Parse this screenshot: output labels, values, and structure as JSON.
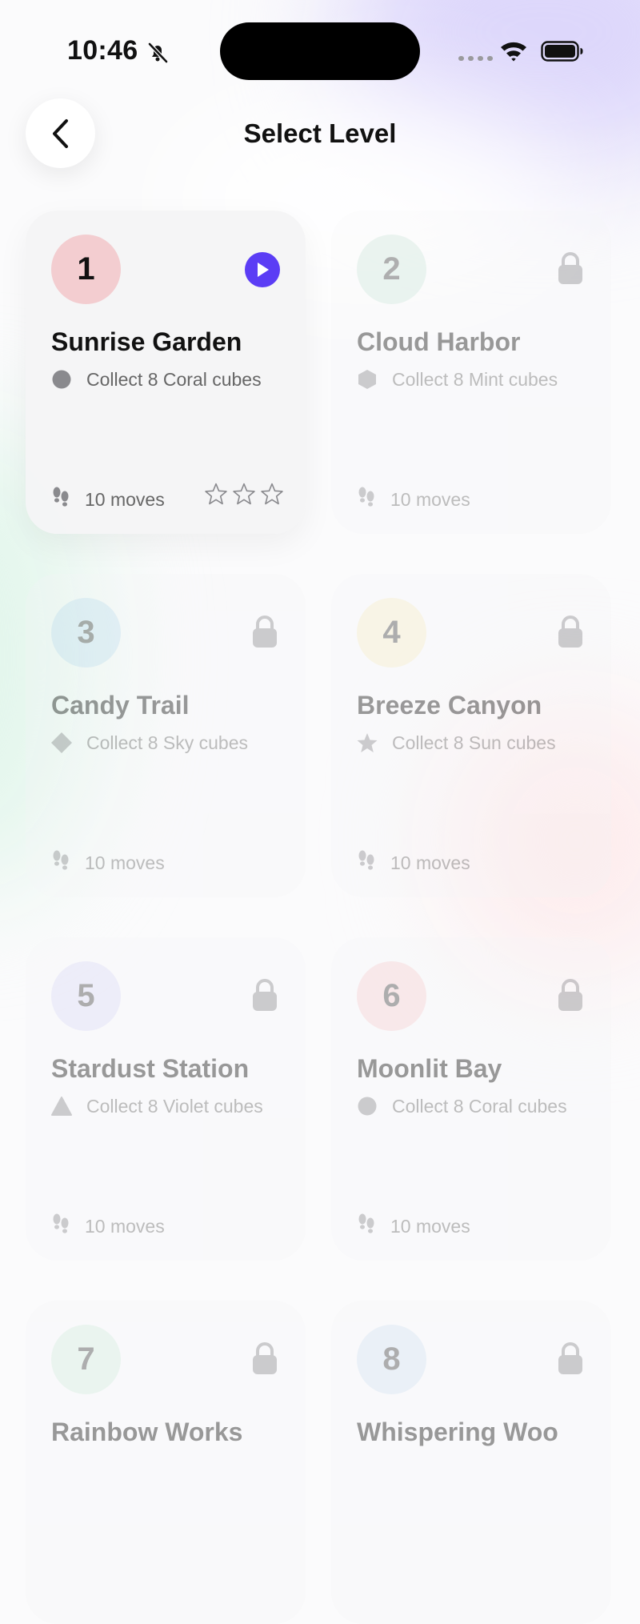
{
  "status_bar": {
    "time": "10:46"
  },
  "nav": {
    "title": "Select Level"
  },
  "levels": [
    {
      "number": "1",
      "name": "Sunrise Garden",
      "goal": "Collect 8 Coral cubes",
      "moves": "10 moves",
      "state": "unlocked",
      "badge_color": "#f3cdd0",
      "shape": "circle",
      "stars": 0
    },
    {
      "number": "2",
      "name": "Cloud Harbor",
      "goal": "Collect 8 Mint cubes",
      "moves": "10 moves",
      "state": "locked",
      "badge_color": "#cfe6dc",
      "shape": "hexagon"
    },
    {
      "number": "3",
      "name": "Candy Trail",
      "goal": "Collect 8 Sky cubes",
      "moves": "10 moves",
      "state": "locked",
      "badge_color": "#c6dff0",
      "shape": "diamond"
    },
    {
      "number": "4",
      "name": "Breeze Canyon",
      "goal": "Collect 8 Sun cubes",
      "moves": "10 moves",
      "state": "locked",
      "badge_color": "#f4ecc9",
      "shape": "star"
    },
    {
      "number": "5",
      "name": "Stardust Station",
      "goal": "Collect 8 Violet cubes",
      "moves": "10 moves",
      "state": "locked",
      "badge_color": "#dcdaf6",
      "shape": "triangle"
    },
    {
      "number": "6",
      "name": "Moonlit Bay",
      "goal": "Collect 8 Coral cubes",
      "moves": "10 moves",
      "state": "locked",
      "badge_color": "#f6d0d2",
      "shape": "circle"
    },
    {
      "number": "7",
      "name": "Rainbow Works",
      "goal": "",
      "moves": "",
      "state": "locked",
      "badge_color": "#d4ecdf",
      "shape": ""
    },
    {
      "number": "8",
      "name": "Whispering Woo",
      "goal": "",
      "moves": "",
      "state": "locked",
      "badge_color": "#d3e3f1",
      "shape": ""
    }
  ],
  "colors": {
    "accent": "#5b3df5",
    "text": "#111111",
    "secondary": "#666666"
  }
}
